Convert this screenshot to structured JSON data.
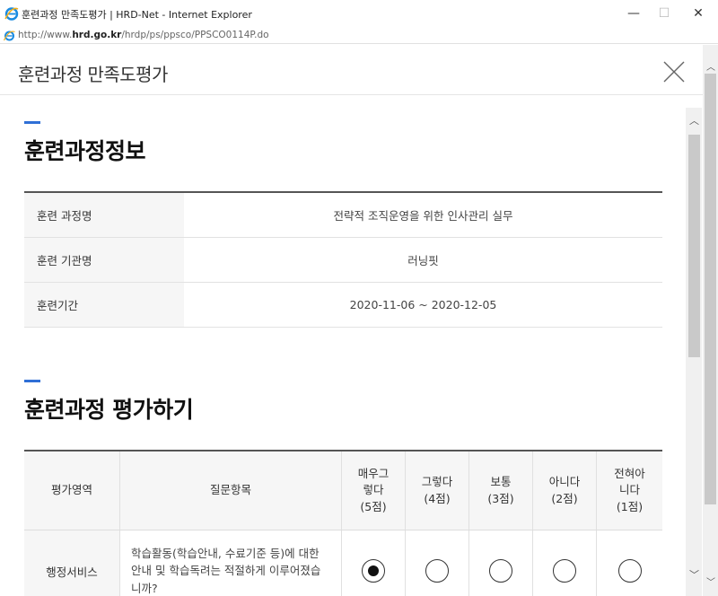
{
  "window": {
    "title": "훈련과정 만족도평가 | HRD-Net - Internet Explorer",
    "minimize": "—",
    "maximize": "☐",
    "close": "✕"
  },
  "address": {
    "prefix": "http://www.",
    "domain": "hrd.go.kr",
    "path": "/hrdp/ps/ppsco/PPSCO0114P.do"
  },
  "popup": {
    "title": "훈련과정 만족도평가"
  },
  "course_info": {
    "section_title": "훈련과정정보",
    "rows": [
      {
        "label": "훈련 과정명",
        "value": "전략적 조직운영을 위한 인사관리 실무"
      },
      {
        "label": "훈련 기관명",
        "value": "러닝핏"
      },
      {
        "label": "훈련기간",
        "value": "2020-11-06 ~ 2020-12-05"
      }
    ]
  },
  "evaluation": {
    "section_title": "훈련과정 평가하기",
    "headers": {
      "area": "평가영역",
      "question": "질문항목",
      "opt1_line1": "매우그",
      "opt1_line2": "렇다",
      "opt1_line3": "(5점)",
      "opt2_line1": "그렇다",
      "opt2_line2": "(4점)",
      "opt3_line1": "보통",
      "opt3_line2": "(3점)",
      "opt4_line1": "아니다",
      "opt4_line2": "(2점)",
      "opt5_line1": "전혀아",
      "opt5_line2": "니다",
      "opt5_line3": "(1점)"
    },
    "rows": [
      {
        "area": "행정서비스",
        "question": "학습활동(학습안내, 수료기준 등)에 대한 안내 및 학습독려는 적절하게 이루어졌습니까?",
        "selected_score": 5
      }
    ]
  },
  "icons": {
    "ie": "internet-explorer-icon",
    "page": "page-icon",
    "close": "close-x-icon"
  },
  "colors": {
    "accent_bar": "#2f6fd6",
    "table_header_bg": "#f6f6f6"
  }
}
